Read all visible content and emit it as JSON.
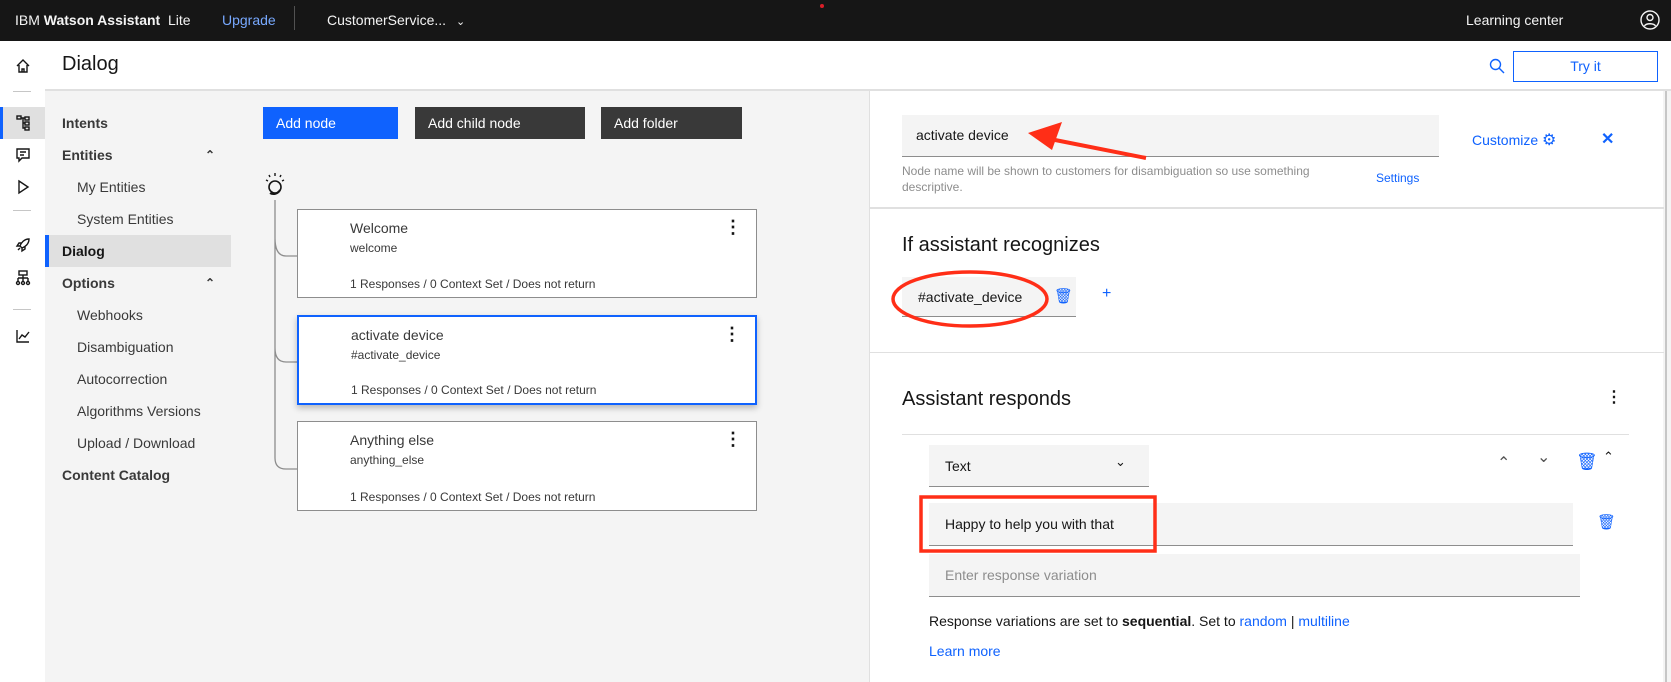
{
  "topbar": {
    "brand_plain": "IBM ",
    "brand_bold": "Watson Assistant",
    "plan": "Lite",
    "upgrade": "Upgrade",
    "workspace": "CustomerService...",
    "learning_center": "Learning center"
  },
  "header": {
    "title": "Dialog",
    "try_it": "Try it"
  },
  "nav": {
    "items": [
      {
        "label": "Intents"
      },
      {
        "label": "Entities"
      },
      {
        "label": "My Entities"
      },
      {
        "label": "System Entities"
      },
      {
        "label": "Dialog"
      },
      {
        "label": "Options"
      },
      {
        "label": "Webhooks"
      },
      {
        "label": "Disambiguation"
      },
      {
        "label": "Autocorrection"
      },
      {
        "label": "Algorithms Versions"
      },
      {
        "label": "Upload / Download"
      },
      {
        "label": "Content Catalog"
      }
    ]
  },
  "toolbar": {
    "add_node": "Add node",
    "add_child_node": "Add child node",
    "add_folder": "Add folder"
  },
  "nodes": [
    {
      "title": "Welcome",
      "condition": "welcome",
      "summary": "1 Responses / 0 Context Set / Does not return"
    },
    {
      "title": "activate device",
      "condition": "#activate_device",
      "summary": "1 Responses / 0 Context Set / Does not return"
    },
    {
      "title": "Anything else",
      "condition": "anything_else",
      "summary": "1 Responses / 0 Context Set / Does not return"
    }
  ],
  "editor": {
    "node_name": "activate device",
    "help_text": "Node name will be shown to customers for disambiguation so use something descriptive.",
    "settings": "Settings",
    "customize": "Customize",
    "recognizes_title": "If assistant recognizes",
    "condition": "#activate_device",
    "add": "+",
    "responds_title": "Assistant responds",
    "response_type": "Text",
    "response_text": "Happy to help you with that",
    "variation_placeholder": "Enter response variation",
    "variation_prefix": "Response variations are set to ",
    "variation_mode": "sequential",
    "variation_mid": ". Set to ",
    "random": "random",
    "sep": " | ",
    "multiline": "multiline",
    "learn_more": "Learn more"
  },
  "colors": {
    "accent": "#0f62fe",
    "annotation": "#ff2e17",
    "topbar": "#161616"
  }
}
